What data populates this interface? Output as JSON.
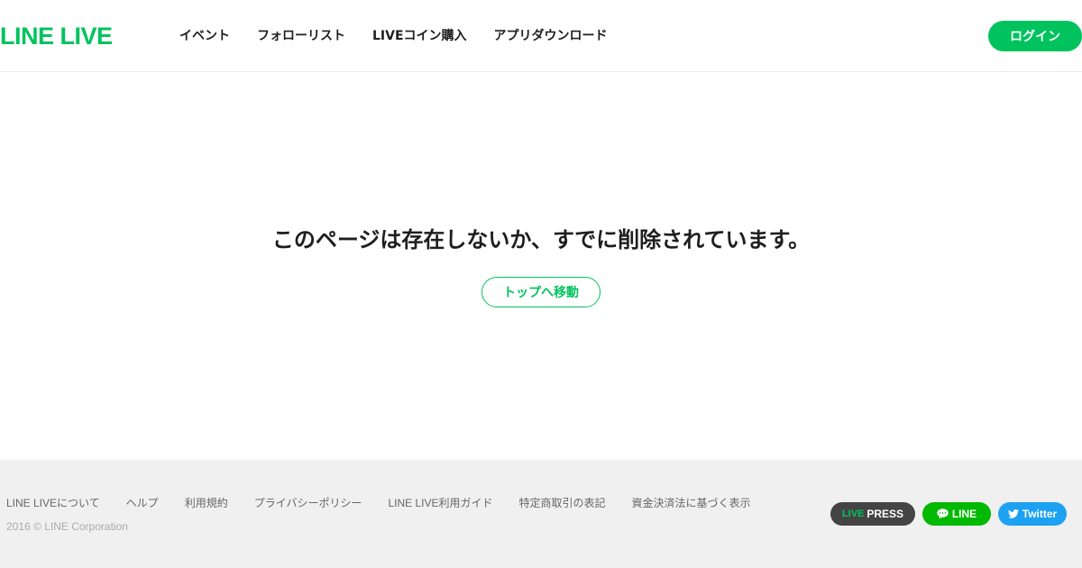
{
  "header": {
    "logo": "LINE LIVE",
    "nav": [
      "イベント",
      "フォローリスト",
      "LIVEコイン購入",
      "アプリダウンロード"
    ],
    "login_label": "ログイン"
  },
  "main": {
    "message": "このページは存在しないか、すでに削除されています。",
    "top_button_label": "トップへ移動"
  },
  "footer": {
    "links": [
      "LINE LIVEについて",
      "ヘルプ",
      "利用規約",
      "プライバシーポリシー",
      "LINE LIVE利用ガイド",
      "特定商取引の表記",
      "資金決済法に基づく表示"
    ],
    "copyright": "2016 © LINE Corporation",
    "social": {
      "press_prefix": "LIVE",
      "press_label": "PRESS",
      "line_label": "LINE",
      "twitter_label": "Twitter"
    }
  },
  "colors": {
    "accent": "#00c35e",
    "line_green": "#00b900",
    "twitter_blue": "#1da1f2",
    "footer_bg": "#f0f0f0"
  },
  "icons": [
    "line-chat-icon",
    "twitter-bird-icon"
  ]
}
